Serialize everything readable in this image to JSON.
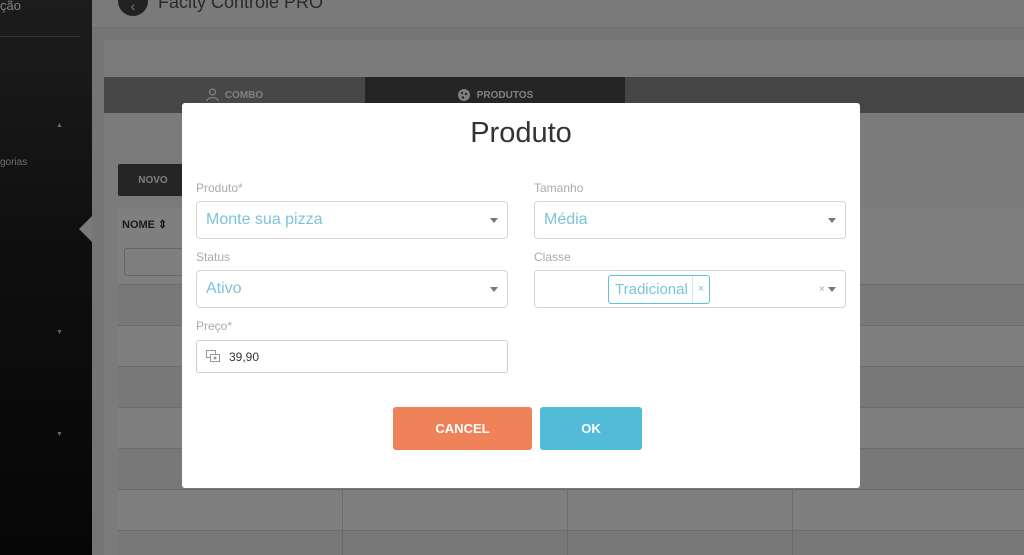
{
  "sidebar": {
    "title_fragment": "ção",
    "category_fragment": "gorias"
  },
  "header": {
    "title": "Facity Controle PRO"
  },
  "tabs": [
    {
      "label": "COMBO",
      "icon": "user-icon"
    },
    {
      "label": "PRODUTOS",
      "icon": "pizza-icon"
    }
  ],
  "toolbar": {
    "novo_label": "NOVO"
  },
  "table": {
    "columns": [
      {
        "label": "NOME ⇕"
      }
    ]
  },
  "modal": {
    "title": "Produto",
    "fields": {
      "produto": {
        "label": "Produto*",
        "value": "Monte sua pizza"
      },
      "tamanho": {
        "label": "Tamanho",
        "value": "Média"
      },
      "status": {
        "label": "Status",
        "value": "Ativo"
      },
      "classe": {
        "label": "Classe",
        "tag": "Tradicional",
        "tag_remove": "×",
        "clear": "×"
      },
      "preco": {
        "label": "Preço*",
        "value": "39,90",
        "icon": "money-icon"
      }
    },
    "buttons": {
      "cancel": "CANCEL",
      "ok": "OK"
    }
  },
  "colors": {
    "cancel": "#f0825a",
    "ok": "#52bbd8",
    "value_text": "#7ec3d8",
    "tab_active": "#4a4a4a"
  }
}
